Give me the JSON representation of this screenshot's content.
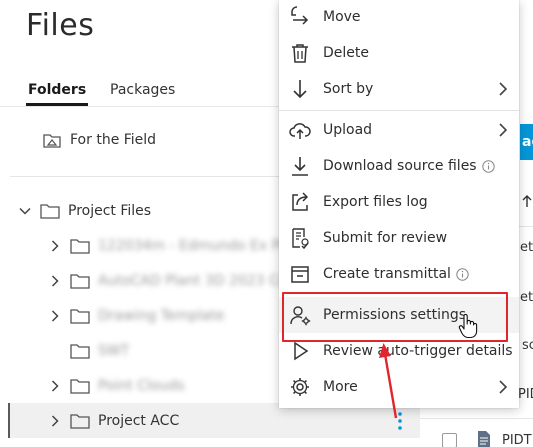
{
  "header": {
    "title": "Files"
  },
  "tabs": [
    {
      "label": "Folders",
      "active": true
    },
    {
      "label": "Packages",
      "active": false
    }
  ],
  "field_item": {
    "label": "For the Field"
  },
  "tree": {
    "root": {
      "label": "Project Files",
      "expanded": true
    },
    "children": [
      {
        "label": "122034m - Edmundo Ex Pro",
        "blurred": true,
        "has_children": true
      },
      {
        "label": "AutoCAD Plant 3D 2023 Colle",
        "blurred": true,
        "has_children": true
      },
      {
        "label": "Drawing Template",
        "blurred": true,
        "has_children": true
      },
      {
        "label": "SWT",
        "blurred": true,
        "has_children": false
      },
      {
        "label": "Point Clouds",
        "blurred": true,
        "has_children": true
      },
      {
        "label": "Project ACC",
        "blurred": false,
        "has_children": true,
        "selected": true
      }
    ]
  },
  "right_panel": {
    "button_fragment": "ad",
    "fragments": [
      "etr",
      "etr",
      "sc",
      "PIDT",
      "PIDT"
    ]
  },
  "context_menu": {
    "items": [
      {
        "label": "Move",
        "icon": "move-icon"
      },
      {
        "label": "Delete",
        "icon": "trash-icon"
      },
      {
        "label": "Sort by",
        "icon": "sort-arrow-icon",
        "submenu": true
      },
      {
        "label": "Upload",
        "icon": "cloud-upload-icon",
        "submenu": true
      },
      {
        "label": "Download source files",
        "icon": "download-icon",
        "info": true
      },
      {
        "label": "Export files log",
        "icon": "export-icon"
      },
      {
        "label": "Submit for review",
        "icon": "review-icon"
      },
      {
        "label": "Create transmittal",
        "icon": "transmittal-icon",
        "info": true
      },
      {
        "label": "Permissions settings",
        "icon": "user-gear-icon",
        "highlighted": true
      },
      {
        "label": "Review auto-trigger details",
        "icon": "play-icon"
      },
      {
        "label": "More",
        "icon": "gear-icon",
        "submenu": true
      }
    ]
  },
  "colors": {
    "accent_blue": "#0696d7",
    "highlight_red": "#e0262d",
    "text": "#2e2e2e"
  }
}
